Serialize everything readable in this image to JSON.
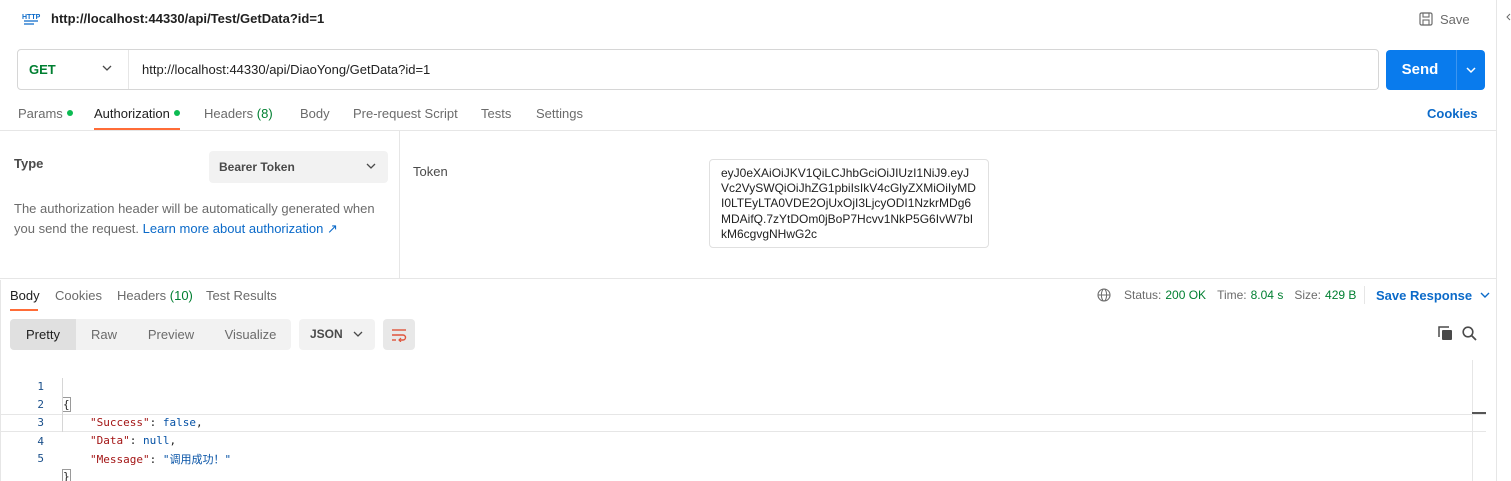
{
  "header": {
    "request_title": "http://localhost:44330/api/Test/GetData?id=1",
    "save_label": "Save"
  },
  "url_bar": {
    "method": "GET",
    "url": "http://localhost:44330/api/DiaoYong/GetData?id=1",
    "send_label": "Send"
  },
  "request_tabs": {
    "params": "Params",
    "authorization": "Authorization",
    "headers": "Headers",
    "headers_count": "(8)",
    "body": "Body",
    "pre_request": "Pre-request Script",
    "tests": "Tests",
    "settings": "Settings",
    "cookies": "Cookies"
  },
  "auth": {
    "type_label": "Type",
    "type_value": "Bearer Token",
    "description": "The authorization header will be automatically generated when you send the request. ",
    "learn_more": "Learn more about authorization ↗",
    "token_label": "Token",
    "token_value": "eyJ0eXAiOiJKV1QiLCJhbGciOiJIUzI1NiJ9.eyJVc2VySWQiOiJhZG1pbiIsIkV4cGlyZXMiOiIyMDI0LTEyLTA0VDE2OjUxOjI3LjcyODI1NzkrMDg6MDAifQ.7zYtDOm0jBoP7Hcvv1NkP5G6IvW7bIkM6cgvgNHwG2c"
  },
  "response_tabs": {
    "body": "Body",
    "cookies": "Cookies",
    "headers": "Headers",
    "headers_count": "(10)",
    "test_results": "Test Results"
  },
  "response_status": {
    "status_label": "Status:",
    "status_value": "200 OK",
    "time_label": "Time:",
    "time_value": "8.04 s",
    "size_label": "Size:",
    "size_value": "429 B",
    "save_response": "Save Response"
  },
  "view_modes": {
    "pretty": "Pretty",
    "raw": "Raw",
    "preview": "Preview",
    "visualize": "Visualize",
    "format": "JSON"
  },
  "code_lines": [
    {
      "n": "1",
      "brace": "{"
    },
    {
      "n": "2",
      "key": "\"Success\"",
      "colon": ": ",
      "value": "false",
      "tail": ","
    },
    {
      "n": "3",
      "key": "\"Data\"",
      "colon": ": ",
      "value": "null",
      "tail": ","
    },
    {
      "n": "4",
      "key": "\"Message\"",
      "colon": ": ",
      "value": "\"调用成功！\""
    },
    {
      "n": "5",
      "brace": "}"
    }
  ],
  "colors": {
    "accent_orange": "#ff6c37",
    "send_blue": "#097bed",
    "link_blue": "#0b6ac9",
    "success_green": "#007f31",
    "dot_green": "#0cbb52"
  }
}
